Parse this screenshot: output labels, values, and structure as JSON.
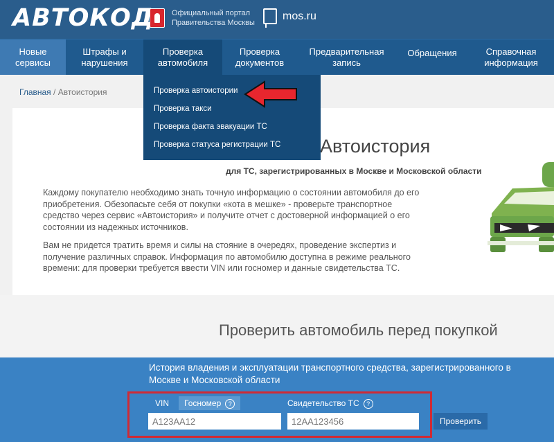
{
  "header": {
    "logo": "АВТОКОД",
    "portal_line1": "Официальный портал",
    "portal_line2": "Правительства Москвы",
    "mos": "mos.ru"
  },
  "nav": {
    "items": [
      {
        "line1": "Новые",
        "line2": "сервисы"
      },
      {
        "line1": "Штрафы и",
        "line2": "нарушения"
      },
      {
        "line1": "Проверка",
        "line2": "автомобиля"
      },
      {
        "line1": "Проверка",
        "line2": "документов"
      },
      {
        "line1": "Предварительная",
        "line2": "запись"
      },
      {
        "line1": "Обращения",
        "line2": ""
      },
      {
        "line1": "Справочная",
        "line2": "информация"
      }
    ],
    "dropdown": [
      "Проверка автоистории",
      "Проверка такси",
      "Проверка факта эвакуации ТС",
      "Проверка статуса регистрации ТС"
    ]
  },
  "breadcrumb": {
    "home": "Главная",
    "separator": " / ",
    "current": "Автоистория"
  },
  "main": {
    "title": "Автоистория",
    "subtitle": "для ТС, зарегистрированных в Москве и Московской области",
    "para1": "Каждому покупателю необходимо знать точную информацию о состоянии автомобиля до его приобретения. Обезопасьте себя от покупки «кота в мешке» - проверьте транспортное средство через сервис «Автоистория» и получите отчет с достоверной информацией о его состоянии из надежных источников.",
    "para2": "Вам не придется тратить время и силы на стояние в очередях, проведение экспертиз и получение различных справок. Информация по автомобилю доступна в режиме реального времени: для проверки требуется ввести VIN или госномер и данные свидетельства ТС."
  },
  "check": {
    "section_title": "Проверить автомобиль перед покупкой",
    "description": "История владения и эксплуатации транспортного средства, зарегистрированного в Москве и Московской области",
    "tab_vin": "VIN",
    "tab_gosnomer": "Госномер",
    "label_svid": "Свидетельство ТС",
    "qmark": "?",
    "input1_placeholder": "А123АА12",
    "input2_placeholder": "12АА123456",
    "button": "Проверить"
  },
  "colors": {
    "header": "#2a5d8c",
    "nav": "#1f5a8e",
    "blue_panel": "#3a82c4",
    "highlight": "#d02a34"
  }
}
